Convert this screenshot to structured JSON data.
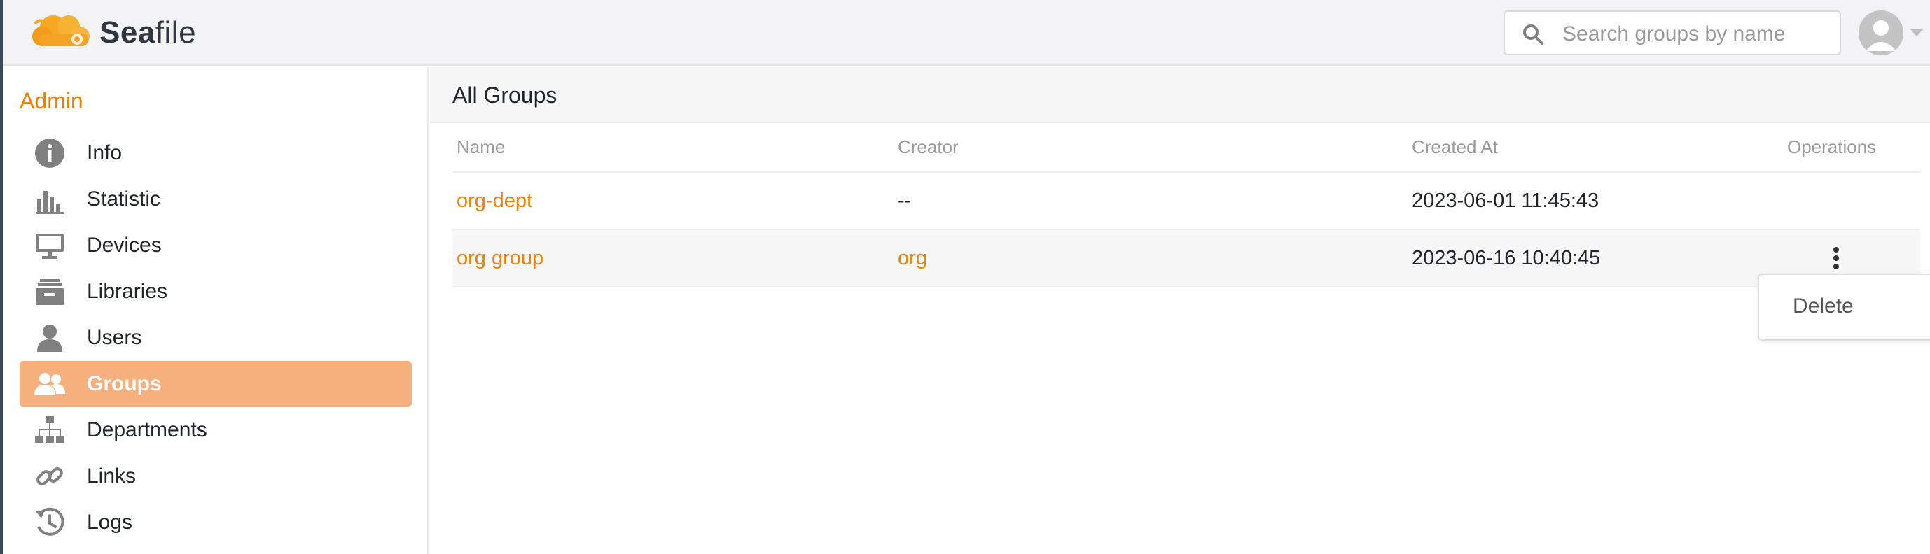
{
  "header": {
    "brand_bold": "Sea",
    "brand_rest": "file",
    "search": {
      "placeholder": "Search groups by name",
      "value": ""
    }
  },
  "sidebar": {
    "heading": "Admin",
    "items": [
      {
        "label": "Info",
        "icon": "info-icon",
        "active": false
      },
      {
        "label": "Statistic",
        "icon": "bar-chart-icon",
        "active": false
      },
      {
        "label": "Devices",
        "icon": "monitor-icon",
        "active": false
      },
      {
        "label": "Libraries",
        "icon": "archive-icon",
        "active": false
      },
      {
        "label": "Users",
        "icon": "user-icon",
        "active": false
      },
      {
        "label": "Groups",
        "icon": "group-icon",
        "active": true
      },
      {
        "label": "Departments",
        "icon": "org-chart-icon",
        "active": false
      },
      {
        "label": "Links",
        "icon": "link-icon",
        "active": false
      },
      {
        "label": "Logs",
        "icon": "history-icon",
        "active": false
      }
    ]
  },
  "main": {
    "title": "All Groups",
    "columns": [
      "Name",
      "Creator",
      "Created At",
      "Operations"
    ],
    "rows": [
      {
        "name": "org-dept",
        "creator": "--",
        "created_at": "2023-06-01 11:45:43"
      },
      {
        "name": "org group",
        "creator": "org",
        "created_at": "2023-06-16 10:40:45"
      }
    ],
    "dropdown": {
      "items": [
        "Delete"
      ]
    }
  },
  "colors": {
    "accent": "#eb8205",
    "active_nav_bg": "#f5b07d",
    "icon_gray": "#808080"
  }
}
